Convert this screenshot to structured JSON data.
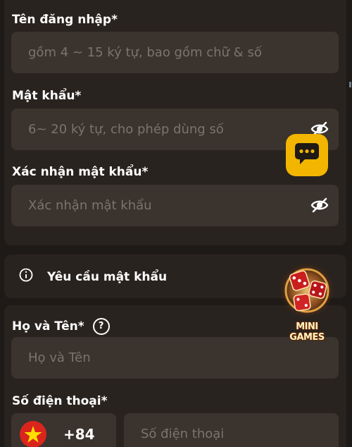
{
  "form": {
    "username": {
      "label": "Tên đăng nhập*",
      "placeholder": "gồm 4 ~ 15 ký tự, bao gồm chữ & số"
    },
    "password": {
      "label": "Mật khẩu*",
      "placeholder": "6~ 20 ký tự, cho phép dùng số",
      "toggle_icon": "eye-off-icon"
    },
    "confirm_password": {
      "label": "Xác nhận mật khẩu*",
      "placeholder": "Xác nhận mật khẩu",
      "toggle_icon": "eye-off-icon"
    },
    "password_requirements": {
      "icon": "info-icon",
      "label": "Yêu cầu mật khẩu"
    },
    "full_name": {
      "label": "Họ và Tên*",
      "help_icon": "?",
      "placeholder": "Họ và Tên"
    },
    "phone": {
      "label": "Số điện thoại*",
      "country_flag": "vietnam-flag-icon",
      "dial_code": "+84",
      "placeholder": "Số điện thoại"
    }
  },
  "floating": {
    "chat_button_icon": "chat-icon",
    "mini_games_label": "MINI GAMES"
  },
  "colors": {
    "background": "#1e1a17",
    "card": "#29231f",
    "input": "#3a332e",
    "placeholder": "#7d736b",
    "chat_accent": "#f2b500",
    "flag_red": "#da251d",
    "flag_star": "#ffde00"
  }
}
